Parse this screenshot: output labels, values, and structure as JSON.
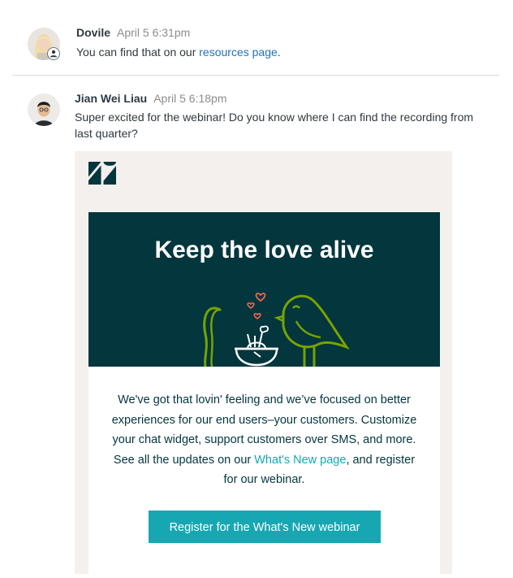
{
  "messages": [
    {
      "author": "Dovile",
      "timestamp": "April 5 6:31pm",
      "text_before": "You can find that on our ",
      "link_text": "resources page",
      "text_after": "."
    },
    {
      "author": "Jian Wei Liau",
      "timestamp": "April 5 6:18pm",
      "text": "Super excited for the webinar! Do you know where I can find the recording from last quarter?"
    }
  ],
  "email": {
    "logo_icon": "zendesk-logo-icon",
    "hero_title": "Keep the love alive",
    "body_before": "We've got that lovin' feeling and we’ve focused on better experiences for our end users–your customers. Customize your chat widget, support customers over SMS, and more. See all the updates on our ",
    "body_link": "What's New page",
    "body_after": ", and register for our webinar.",
    "cta_label": "Register for the What's New webinar"
  },
  "colors": {
    "accent_link": "#1f73b7",
    "teal": "#17a7b3",
    "hero_bg": "#03363d",
    "email_bg": "#f3f0ed",
    "bird_green": "#78a300",
    "heart": "#eb6651"
  }
}
